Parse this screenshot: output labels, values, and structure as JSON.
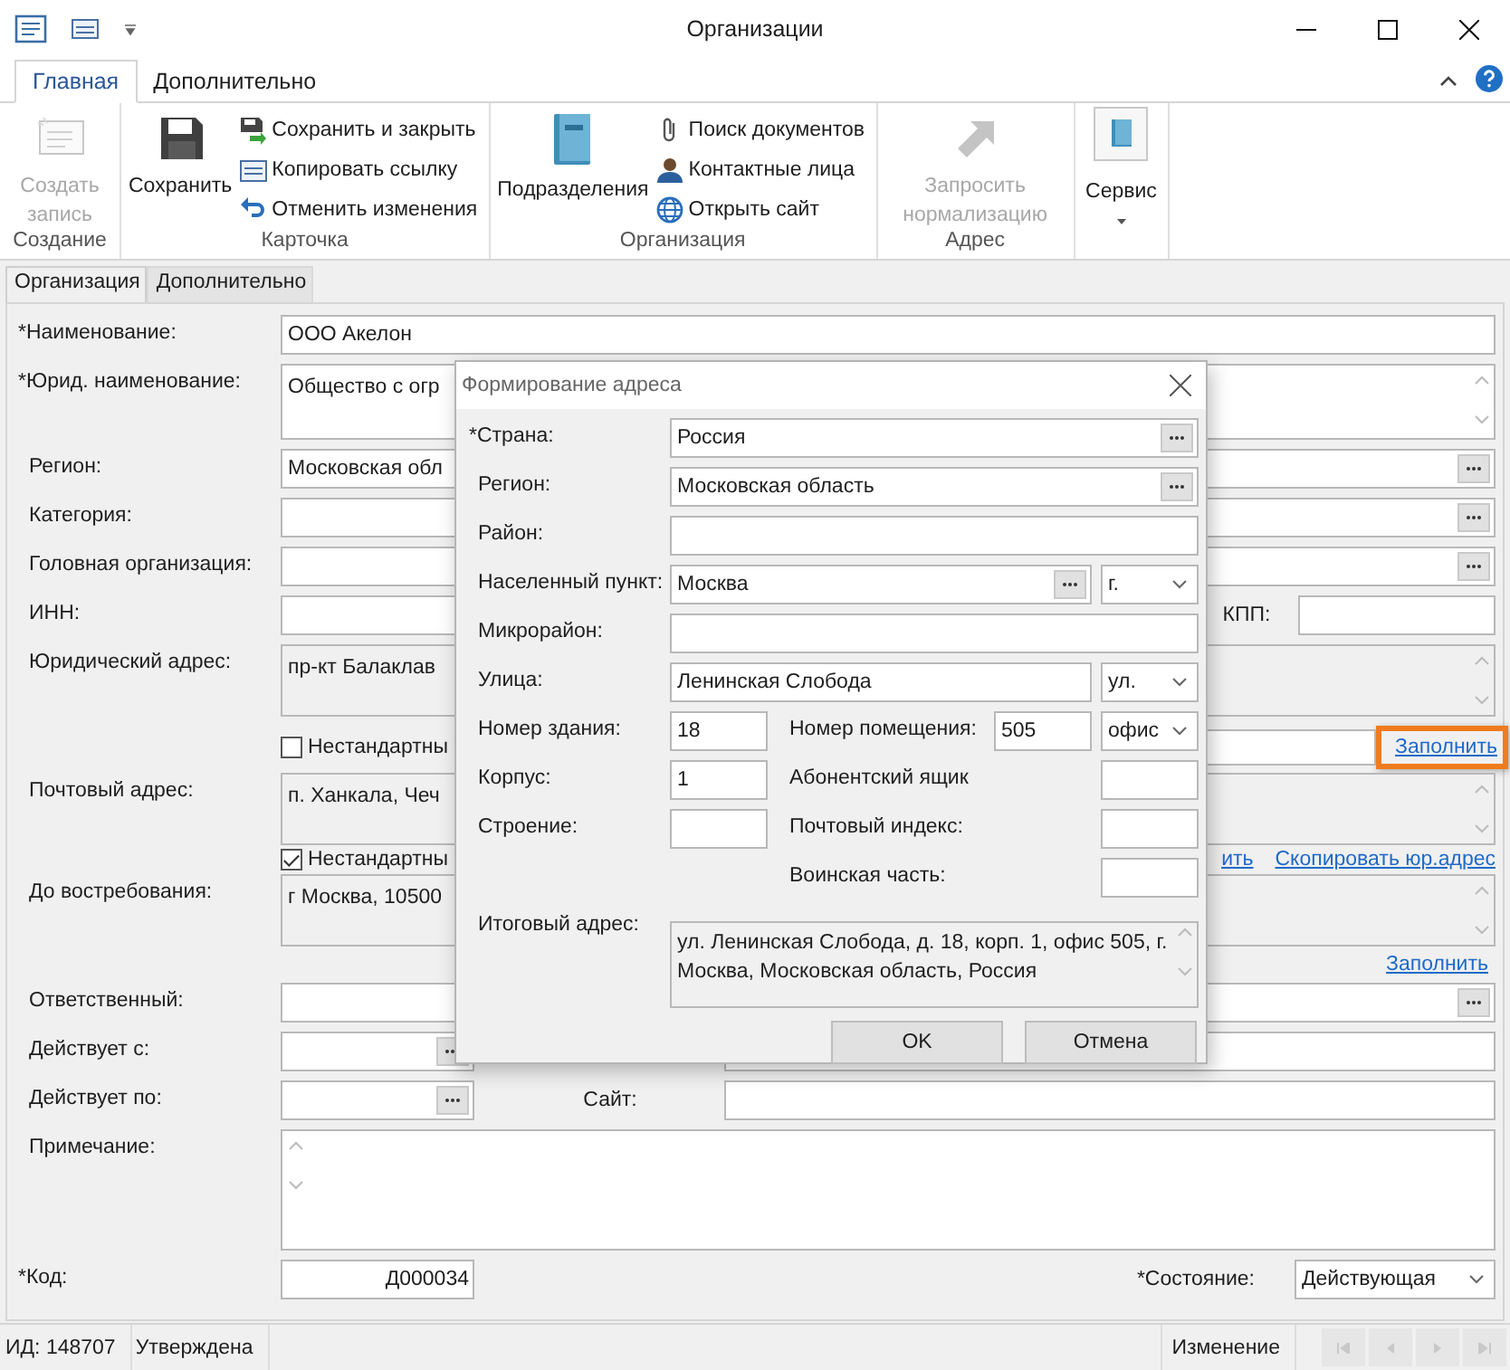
{
  "window": {
    "title": "Организации"
  },
  "ribbon": {
    "tabs": [
      {
        "label": "Главная",
        "selected": true
      },
      {
        "label": "Дополнительно",
        "selected": false
      }
    ],
    "groups": [
      {
        "label": "Создание",
        "items": [
          {
            "label": "Создать запись",
            "kind": "large",
            "disabled": true
          }
        ]
      },
      {
        "label": "Карточка",
        "items": [
          {
            "label": "Сохранить",
            "kind": "large",
            "disabled": false
          },
          {
            "label": "Сохранить и закрыть",
            "kind": "small",
            "disabled": false
          },
          {
            "label": "Копировать ссылку",
            "kind": "small",
            "disabled": false
          },
          {
            "label": "Отменить изменения",
            "kind": "small",
            "disabled": false
          }
        ]
      },
      {
        "label": "Организация",
        "items": [
          {
            "label": "Подразделения",
            "kind": "large",
            "disabled": false
          },
          {
            "label": "Поиск документов",
            "kind": "small",
            "disabled": false
          },
          {
            "label": "Контактные лица",
            "kind": "small",
            "disabled": false
          },
          {
            "label": "Открыть сайт",
            "kind": "small",
            "disabled": false
          }
        ]
      },
      {
        "label": "Адрес",
        "items": [
          {
            "label": "Запросить нормализацию",
            "kind": "large",
            "disabled": true
          }
        ]
      },
      {
        "items": [
          {
            "label": "Сервис",
            "kind": "menu",
            "disabled": false
          }
        ]
      }
    ]
  },
  "form_tabs": [
    {
      "label": "Организация",
      "selected": true
    },
    {
      "label": "Дополнительно",
      "selected": false
    }
  ],
  "form": {
    "name": {
      "label": "*Наименование:",
      "value": "ООО Акелон"
    },
    "legal_name": {
      "label": "*Юрид. наименование:",
      "value": "Общество с огр"
    },
    "region": {
      "label": "Регион:",
      "value": "Московская обл"
    },
    "category": {
      "label": "Категория:"
    },
    "parent_org": {
      "label": "Головная организация:"
    },
    "inn": {
      "label": "ИНН:"
    },
    "kpp": {
      "label": "КПП:"
    },
    "legal_address": {
      "label": "Юридический адрес:",
      "value": "пр-кт Балаклав"
    },
    "legal_nonstandard": {
      "label": "Нестандартны",
      "checked": false
    },
    "legal_fill_link": "Заполнить",
    "postal_address": {
      "label": "Почтовый адрес:",
      "value": "п. Ханкала, Чеч"
    },
    "postal_nonstandard": {
      "label": "Нестандартны",
      "checked": true
    },
    "postal_links": [
      "ить",
      "Скопировать юр.адрес"
    ],
    "on_demand": {
      "label": "До востребования:",
      "value": "г Москва, 10500"
    },
    "on_demand_fill_link": "Заполнить",
    "responsible": {
      "label": "Ответственный:"
    },
    "valid_from": {
      "label": "Действует с:"
    },
    "valid_to": {
      "label": "Действует по:"
    },
    "site": {
      "label": "Сайт:"
    },
    "note": {
      "label": "Примечание:"
    },
    "code": {
      "label": "*Код:",
      "value": "Д000034"
    },
    "state": {
      "label": "*Состояние:",
      "value": "Действующая"
    }
  },
  "dialog": {
    "title": "Формирование адреса",
    "country": {
      "label": "*Страна:",
      "value": "Россия"
    },
    "region": {
      "label": "Регион:",
      "value": "Московская область"
    },
    "district": {
      "label": "Район:"
    },
    "locality": {
      "label": "Населенный пункт:",
      "value": "Москва",
      "type": "г."
    },
    "microdistrict": {
      "label": "Микрорайон:"
    },
    "street": {
      "label": "Улица:",
      "value": "Ленинская Слобода",
      "type": "ул."
    },
    "building": {
      "label": "Номер здания:",
      "value": "18"
    },
    "room": {
      "label": "Номер помещения:",
      "value": "505",
      "type": "офис"
    },
    "corpus": {
      "label": "Корпус:",
      "value": "1"
    },
    "po_box": {
      "label": "Абонентский ящик"
    },
    "structure": {
      "label": "Строение:"
    },
    "postcode": {
      "label": "Почтовый индекс:"
    },
    "military": {
      "label": "Воинская часть:"
    },
    "result": {
      "label": "Итоговый адрес:",
      "value": "ул. Ленинская Слобода, д. 18, корп. 1, офис 505, г. Москва, Московская область, Россия"
    },
    "buttons": [
      "OK",
      "Отмена"
    ]
  },
  "status_bar": {
    "id": "ИД: 148707",
    "status": "Утверждена",
    "mode": "Изменение"
  }
}
